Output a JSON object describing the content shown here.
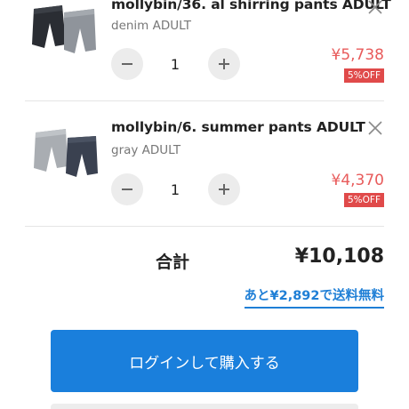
{
  "cart": {
    "items": [
      {
        "title": "mollybin/36. al shirring pants ADULT",
        "variant": "denim ADULT",
        "quantity": "1",
        "price": "¥5,738",
        "discount": "5%OFF",
        "thumbnail_icon": "pants-pair-image"
      },
      {
        "title": "mollybin/6. summer pants ADULT",
        "variant": "gray ADULT",
        "quantity": "1",
        "price": "¥4,370",
        "discount": "5%OFF",
        "thumbnail_icon": "pants-pair-image"
      }
    ],
    "icons": {
      "remove": "close-icon",
      "decrement": "minus-icon",
      "increment": "plus-icon"
    }
  },
  "summary": {
    "total_label": "合計",
    "total_value": "¥10,108",
    "free_shipping_text": "あと¥2,892で送料無料"
  },
  "actions": {
    "login_purchase_label": "ログインして購入する"
  },
  "colors": {
    "accent": "#1a7fdc",
    "price": "#e85b5b",
    "discount_badge": "#e04a4a",
    "link": "#1f7fd6"
  }
}
